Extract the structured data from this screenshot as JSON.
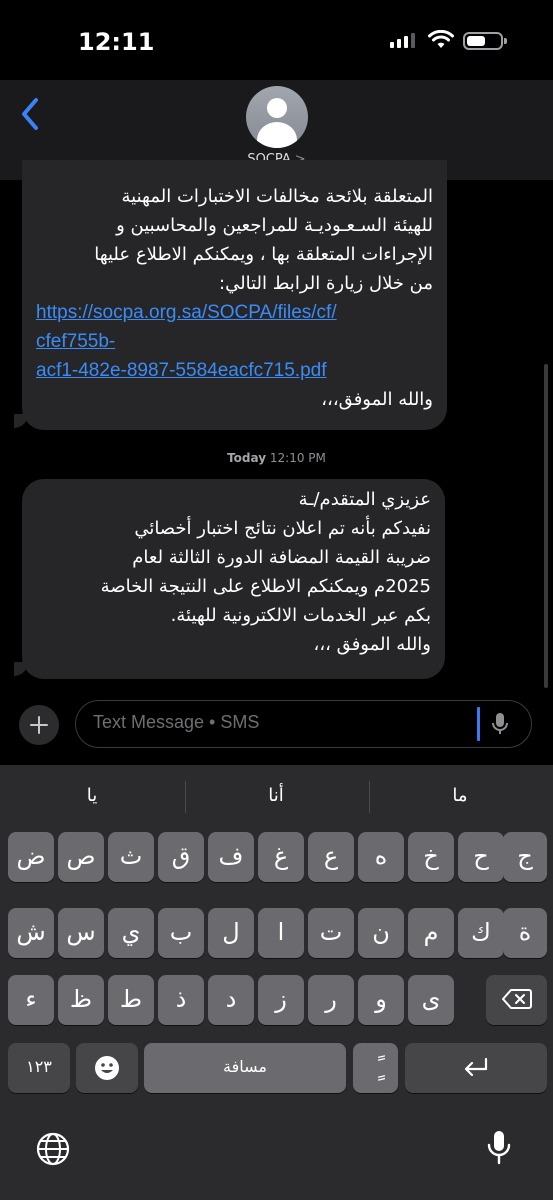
{
  "status_bar": {
    "time": "12:11"
  },
  "header": {
    "contact_name": "SOCPA",
    "chevron": ">"
  },
  "messages": [
    {
      "lines": [
        "المتعلقة بلائحة مخالفات الاختبارات المهنية",
        "للهيئة السـعـوديـة للمراجعين والمحاسبين و",
        "الإجراءات المتعلقة بها ، ويمكنكم الاطلاع عليها",
        "من خلال زيارة الرابط التالي:"
      ],
      "link_lines": [
        "https://socpa.org.sa/SOCPA/files/cf/",
        "cfef755b-",
        "acf1-482e-8987-5584eacfc715.pdf"
      ],
      "closing": "والله الموفق،،،"
    },
    {
      "lines": [
        "عزيزي المتقدم/ـة",
        "نفيدكم بأنه تم اعلان نتائج اختبار أخصائي",
        "ضريبة القيمة المضافة الدورة الثالثة لعام",
        "2025م ويمكنكم الاطلاع على النتيجة الخاصة",
        "بكم عبر الخدمات الالكترونية للهيئة.",
        "والله الموفق ،،،"
      ]
    }
  ],
  "timestamp": {
    "day": "Today",
    "time": "12:10 PM"
  },
  "composer": {
    "placeholder": "Text Message • SMS"
  },
  "suggestions": [
    "يا",
    "أنا",
    "ما"
  ],
  "keyboard": {
    "row1": [
      "ض",
      "ص",
      "ث",
      "ق",
      "ف",
      "غ",
      "ع",
      "ه",
      "خ",
      "ح",
      "ج"
    ],
    "row2": [
      "ش",
      "س",
      "ي",
      "ب",
      "ل",
      "ا",
      "ت",
      "ن",
      "م",
      "ك",
      "ة"
    ],
    "row3": [
      "ء",
      "ظ",
      "ط",
      "ذ",
      "د",
      "ز",
      "ر",
      "و",
      "ى"
    ],
    "numbers_label": "١٢٣",
    "space_label": "مسافة",
    "tashkeel_label": "ًٍ"
  }
}
